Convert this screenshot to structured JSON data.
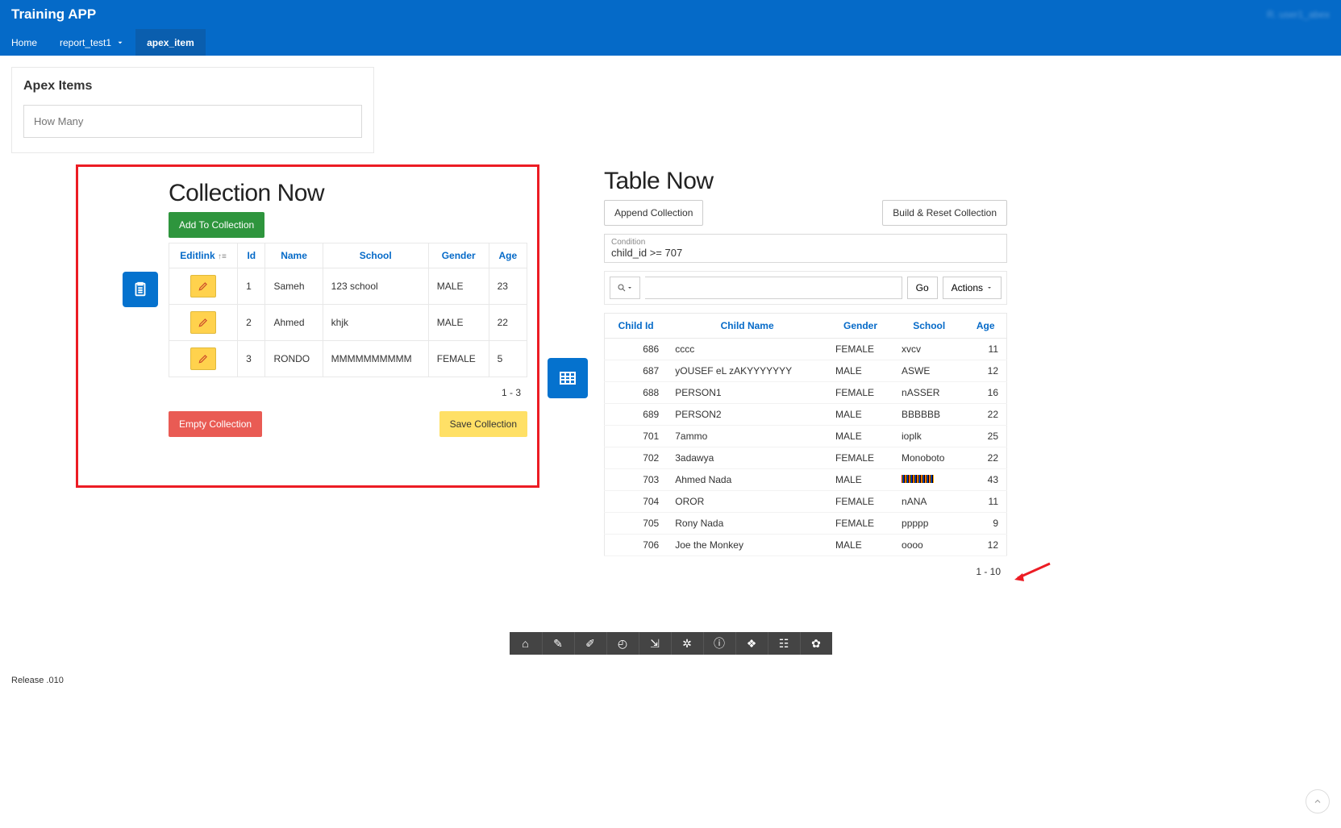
{
  "header": {
    "app_title": "Training APP",
    "user_label": "R. user1_abex",
    "nav": [
      {
        "label": "Home",
        "active": false,
        "dropdown": false
      },
      {
        "label": "report_test1",
        "active": false,
        "dropdown": true
      },
      {
        "label": "apex_item",
        "active": true,
        "dropdown": false
      }
    ]
  },
  "apex_items_region": {
    "title": "Apex Items",
    "input_placeholder": "How Many"
  },
  "collection_region": {
    "title": "Collection Now",
    "add_btn": "Add To Collection",
    "columns": [
      "Editlink",
      "Id",
      "Name",
      "School",
      "Gender",
      "Age"
    ],
    "sort_col": "Editlink",
    "rows": [
      {
        "id": "1",
        "name": "Sameh",
        "school": "123 school",
        "gender": "MALE",
        "age": "23"
      },
      {
        "id": "2",
        "name": "Ahmed",
        "school": "khjk",
        "gender": "MALE",
        "age": "22"
      },
      {
        "id": "3",
        "name": "RONDO",
        "school": "MMMMMMMMMM",
        "gender": "FEMALE",
        "age": "5"
      }
    ],
    "pager": "1 - 3",
    "empty_btn": "Empty Collection",
    "save_btn": "Save Collection"
  },
  "table_region": {
    "title": "Table Now",
    "append_btn": "Append Collection",
    "build_btn": "Build & Reset Collection",
    "condition_label": "Condition",
    "condition_value": "child_id >= 707",
    "go_btn": "Go",
    "actions_btn": "Actions",
    "columns": [
      "Child Id",
      "Child Name",
      "Gender",
      "School",
      "Age"
    ],
    "rows": [
      {
        "id": "686",
        "name": "cccc",
        "gender": "FEMALE",
        "school": "xvcv",
        "age": "11"
      },
      {
        "id": "687",
        "name": "yOUSEF eL zAKYYYYYYY",
        "gender": "MALE",
        "school": "ASWE",
        "age": "12"
      },
      {
        "id": "688",
        "name": "PERSON1",
        "gender": "FEMALE",
        "school": "nASSER",
        "age": "16"
      },
      {
        "id": "689",
        "name": "PERSON2",
        "gender": "MALE",
        "school": "BBBBBB",
        "age": "22"
      },
      {
        "id": "701",
        "name": "7ammo",
        "gender": "MALE",
        "school": "ioplk",
        "age": "25"
      },
      {
        "id": "702",
        "name": "3adawya",
        "gender": "FEMALE",
        "school": "Monoboto",
        "age": "22"
      },
      {
        "id": "703",
        "name": "Ahmed Nada",
        "gender": "MALE",
        "school": "__BARCODE__",
        "age": "43"
      },
      {
        "id": "704",
        "name": "OROR",
        "gender": "FEMALE",
        "school": "nANA",
        "age": "11"
      },
      {
        "id": "705",
        "name": "Rony Nada",
        "gender": "FEMALE",
        "school": "ppppp",
        "age": "9"
      },
      {
        "id": "706",
        "name": "Joe the Monkey",
        "gender": "MALE",
        "school": "oooo",
        "age": "12"
      }
    ],
    "pager": "1 - 10"
  },
  "dev_toolbar_icons": [
    "home-icon",
    "edit-page-icon",
    "quick-edit-icon",
    "session-icon",
    "view-debug-icon",
    "debug-icon",
    "info-icon",
    "theme-roller-icon",
    "template-options-icon",
    "settings-icon"
  ],
  "footer": {
    "release": "Release .010"
  }
}
